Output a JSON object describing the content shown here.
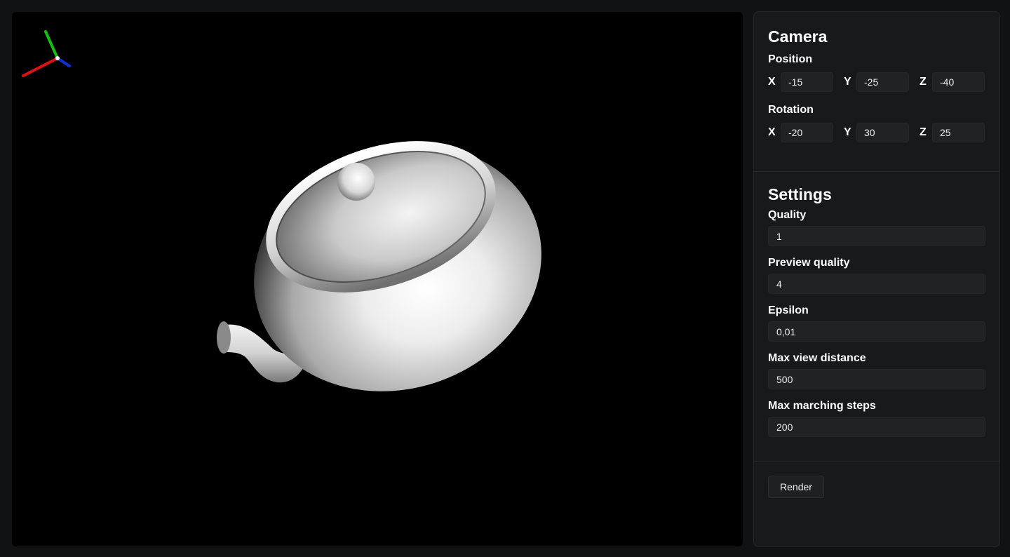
{
  "camera": {
    "title": "Camera",
    "position": {
      "label": "Position",
      "x_label": "X",
      "y_label": "Y",
      "z_label": "Z",
      "x": "-15",
      "y": "-25",
      "z": "-40"
    },
    "rotation": {
      "label": "Rotation",
      "x_label": "X",
      "y_label": "Y",
      "z_label": "Z",
      "x": "-20",
      "y": "30",
      "z": "25"
    }
  },
  "settings": {
    "title": "Settings",
    "quality": {
      "label": "Quality",
      "value": "1"
    },
    "preview_quality": {
      "label": "Preview quality",
      "value": "4"
    },
    "epsilon": {
      "label": "Epsilon",
      "value": "0,01"
    },
    "max_view_distance": {
      "label": "Max view distance",
      "value": "500"
    },
    "max_marching_steps": {
      "label": "Max marching steps",
      "value": "200"
    }
  },
  "render_button": "Render",
  "gizmo": {
    "x_color": "#e01010",
    "y_color": "#10c010",
    "z_color": "#1030e0",
    "origin_color": "#ffffff"
  },
  "viewport": {
    "background": "#000000",
    "object": "teapot"
  }
}
